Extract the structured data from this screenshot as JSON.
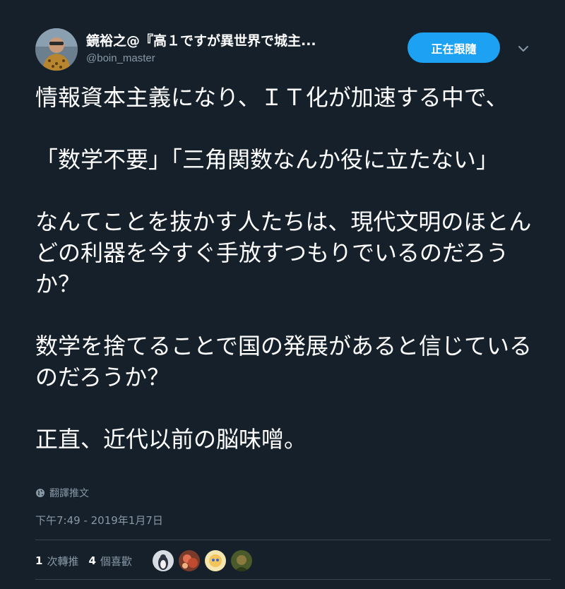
{
  "author": {
    "display_name": "鏡裕之@『高１ですが異世界で城主...",
    "handle": "@boin_master"
  },
  "follow_button_label": "正在跟隨",
  "body_paragraphs": [
    "情報資本主義になり、ＩＴ化が加速する中で、",
    "「数学不要」「三角関数なんか役に立たない」",
    "なんてことを抜かす人たちは、現代文明のほとんどの利器を今すぐ手放すつもりでいるのだろうか？",
    "数学を捨てることで国の発展があると信じているのだろうか？",
    "正直、近代以前の脳味噌。"
  ],
  "translate_label": "翻譯推文",
  "timestamp": "下午7:49 - 2019年1月7日",
  "stats": {
    "retweets_count": "1",
    "retweets_label": "次轉推",
    "likes_count": "4",
    "likes_label": "個喜歡"
  },
  "icons": {
    "chevron": "chevron-down-icon",
    "globe": "globe-icon"
  },
  "colors": {
    "background": "#15202b",
    "accent": "#1da1f2",
    "secondary_text": "#8899a6",
    "divider": "#38444d"
  }
}
